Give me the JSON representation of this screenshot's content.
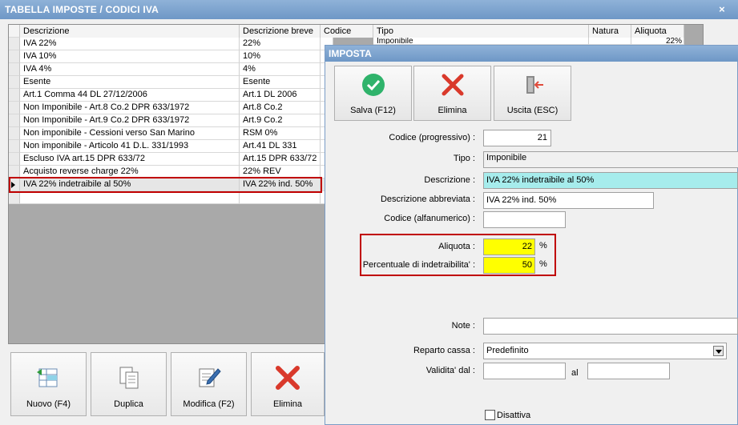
{
  "window": {
    "title": "TABELLA IMPOSTE / CODICI IVA",
    "close": "×"
  },
  "grid": {
    "columns": [
      "Descrizione",
      "Descrizione breve",
      "Codice",
      "Tipo",
      "Natura",
      "Aliquota"
    ],
    "partial_row_tipo": "Imponibile",
    "partial_row_aliquota": "22%",
    "rows": [
      {
        "descrizione": "IVA 22%",
        "breve": "22%"
      },
      {
        "descrizione": "IVA 10%",
        "breve": "10%"
      },
      {
        "descrizione": "IVA 4%",
        "breve": "4%"
      },
      {
        "descrizione": "Esente",
        "breve": "Esente"
      },
      {
        "descrizione": "Art.1 Comma 44 DL 27/12/2006",
        "breve": "Art.1 DL 2006"
      },
      {
        "descrizione": "Non Imponibile - Art.8 Co.2 DPR 633/1972",
        "breve": "Art.8 Co.2"
      },
      {
        "descrizione": "Non Imponibile - Art.9 Co.2 DPR 633/1972",
        "breve": "Art.9 Co.2"
      },
      {
        "descrizione": "Non imponibile - Cessioni verso San Marino",
        "breve": "RSM 0%"
      },
      {
        "descrizione": "Non imponibile - Articolo 41 D.L. 331/1993",
        "breve": "Art.41 DL 331"
      },
      {
        "descrizione": "Escluso IVA art.15 DPR 633/72",
        "breve": "Art.15 DPR 633/72"
      },
      {
        "descrizione": "Acquisto reverse charge 22%",
        "breve": "22% REV"
      },
      {
        "descrizione": "IVA 22% indetraibile al 50%",
        "breve": "IVA 22% ind. 50%"
      }
    ]
  },
  "bottom_buttons": {
    "nuovo": "Nuovo (F4)",
    "duplica": "Duplica",
    "modifica": "Modifica (F2)",
    "elimina": "Elimina"
  },
  "dialog": {
    "title": "IMPOSTA",
    "buttons": {
      "salva": "Salva (F12)",
      "elimina": "Elimina",
      "uscita": "Uscita (ESC)"
    },
    "fields": {
      "codice_label": "Codice (progressivo) :",
      "codice_value": "21",
      "tipo_label": "Tipo :",
      "tipo_value": "Imponibile",
      "descrizione_label": "Descrizione :",
      "descrizione_value": "IVA 22% indetraibile al 50%",
      "descr_abbr_label": "Descrizione abbreviata :",
      "descr_abbr_value": "IVA 22% ind. 50%",
      "codice_alfa_label": "Codice (alfanumerico) :",
      "codice_alfa_value": "",
      "aliquota_label": "Aliquota :",
      "aliquota_value": "22",
      "aliquota_unit": "%",
      "perc_label": "Percentuale di indetraibilita' :",
      "perc_value": "50",
      "perc_unit": "%",
      "note_label": "Note :",
      "note_value": "",
      "reparto_label": "Reparto cassa :",
      "reparto_value": "Predefinito",
      "validita_label": "Validita' dal :",
      "validita_dal": "",
      "al_label": "al",
      "validita_al": "",
      "disattiva_label": "Disattiva"
    }
  },
  "colors": {
    "title_bar": "#7aa1cf",
    "highlight_red": "#c00000",
    "cyan_field": "#a6ecec",
    "yellow_field": "#ffff00"
  }
}
